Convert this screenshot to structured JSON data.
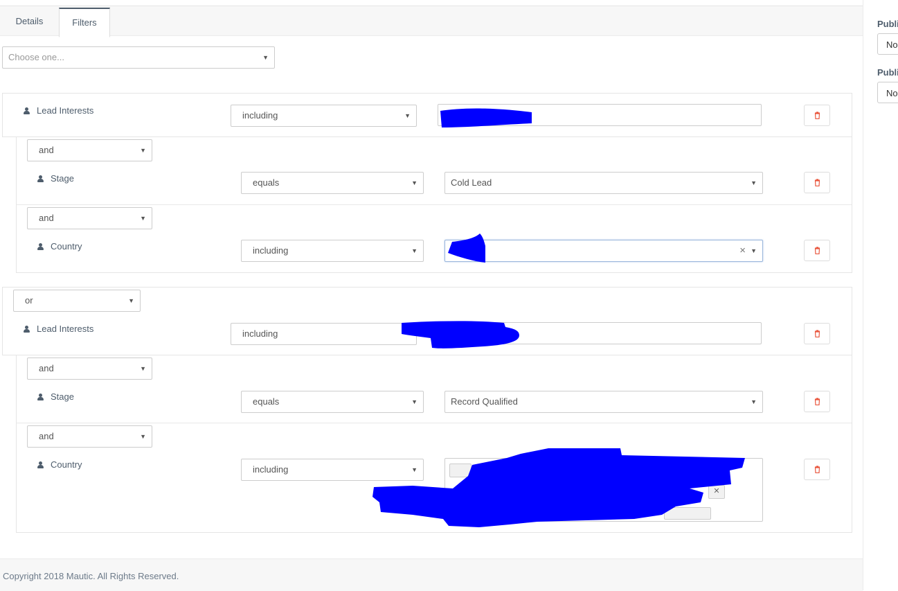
{
  "tabs": [
    {
      "label": "Details",
      "active": false
    },
    {
      "label": "Filters",
      "active": true
    }
  ],
  "filter_chooser": {
    "placeholder": "Choose one..."
  },
  "groups": [
    {
      "rows": [
        {
          "glue": "",
          "field": "Lead Interests",
          "operator": "including",
          "value": ""
        },
        {
          "glue": "and",
          "field": "Stage",
          "operator": "equals",
          "value": "Cold Lead"
        },
        {
          "glue": "and",
          "field": "Country",
          "operator": "including",
          "value": ""
        }
      ]
    },
    {
      "glue": "or",
      "rows": [
        {
          "glue": "",
          "field": "Lead Interests",
          "operator": "including",
          "value": ""
        },
        {
          "glue": "and",
          "field": "Stage",
          "operator": "equals",
          "value": "Record Qualified"
        },
        {
          "glue": "and",
          "field": "Country",
          "operator": "including",
          "value": ""
        }
      ]
    }
  ],
  "sidebar": {
    "labels": [
      "Publi",
      "Publi"
    ],
    "values": [
      "No",
      "No"
    ]
  },
  "footer": {
    "copyright": "Copyright 2018 Mautic. All Rights Reserved."
  },
  "colors": {
    "redaction": "#0000ff",
    "delete_icon": "#e9573f",
    "text": "#4e5d6c"
  },
  "icons": [
    "user-icon",
    "trash-icon",
    "caret-down-icon",
    "clear-icon"
  ]
}
